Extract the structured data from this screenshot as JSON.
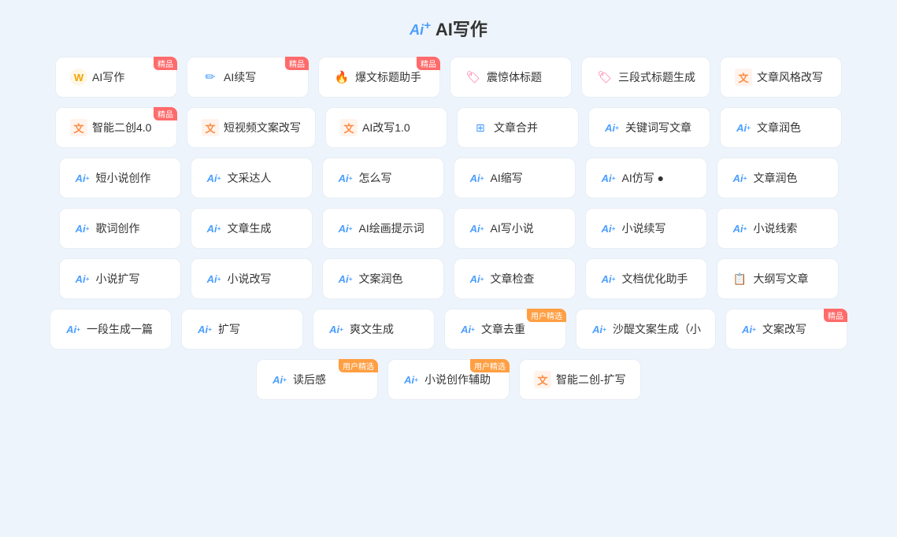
{
  "title": {
    "ai_prefix": "Ai+",
    "text": "AI写作"
  },
  "rows": [
    [
      {
        "id": "ai-write",
        "icon": "w-circle",
        "label": "AI写作",
        "badge": "精品"
      },
      {
        "id": "ai-continue",
        "icon": "pen",
        "label": "AI续写",
        "badge": "精品"
      },
      {
        "id": "headline-helper",
        "icon": "fire",
        "label": "爆文标题助手",
        "badge": "精品"
      },
      {
        "id": "shock-title",
        "icon": "tag-pink",
        "label": "震惊体标题",
        "badge": null
      },
      {
        "id": "three-title",
        "icon": "tag-pink",
        "label": "三段式标题生成",
        "badge": null
      },
      {
        "id": "article-style",
        "icon": "w-orange",
        "label": "文章风格改写",
        "badge": null
      }
    ],
    [
      {
        "id": "smart-create",
        "icon": "w-orange",
        "label": "智能二创4.0",
        "badge": "精品"
      },
      {
        "id": "short-video",
        "icon": "w-orange",
        "label": "短视频文案改写",
        "badge": null
      },
      {
        "id": "ai-rewrite",
        "icon": "w-orange",
        "label": "AI改写1.0",
        "badge": null
      },
      {
        "id": "article-merge",
        "icon": "merge",
        "label": "文章合并",
        "badge": null
      },
      {
        "id": "keyword-write",
        "icon": "ai-plus",
        "label": "关键词写文章",
        "badge": null
      },
      {
        "id": "article-polish",
        "icon": "ai-plus",
        "label": "文章润色",
        "badge": null
      }
    ],
    [
      {
        "id": "short-novel",
        "icon": "ai-plus",
        "label": "短小说创作",
        "badge": null
      },
      {
        "id": "literary",
        "icon": "ai-plus",
        "label": "文采达人",
        "badge": null
      },
      {
        "id": "how-write",
        "icon": "ai-plus",
        "label": "怎么写",
        "badge": null
      },
      {
        "id": "ai-shorten",
        "icon": "ai-plus",
        "label": "AI缩写",
        "badge": null
      },
      {
        "id": "ai-imitate",
        "icon": "ai-plus",
        "label": "AI仿写 ●",
        "badge": null
      },
      {
        "id": "article-polish2",
        "icon": "ai-plus",
        "label": "文章润色",
        "badge": null
      }
    ],
    [
      {
        "id": "lyric",
        "icon": "ai-plus",
        "label": "歌词创作",
        "badge": null
      },
      {
        "id": "article-gen",
        "icon": "ai-plus",
        "label": "文章生成",
        "badge": null
      },
      {
        "id": "ai-draw-prompt",
        "icon": "ai-plus",
        "label": "AI绘画提示词",
        "badge": null
      },
      {
        "id": "ai-novel-write",
        "icon": "ai-plus",
        "label": "AI写小说",
        "badge": null
      },
      {
        "id": "novel-continue",
        "icon": "ai-plus",
        "label": "小说续写",
        "badge": null
      },
      {
        "id": "novel-clue",
        "icon": "ai-plus",
        "label": "小说线索",
        "badge": null
      }
    ],
    [
      {
        "id": "novel-expand",
        "icon": "ai-plus",
        "label": "小说扩写",
        "badge": null
      },
      {
        "id": "novel-rewrite",
        "icon": "ai-plus",
        "label": "小说改写",
        "badge": null
      },
      {
        "id": "copy-polish",
        "icon": "ai-plus",
        "label": "文案润色",
        "badge": null
      },
      {
        "id": "article-check",
        "icon": "ai-plus",
        "label": "文章检查",
        "badge": null
      },
      {
        "id": "doc-optimize",
        "icon": "ai-plus",
        "label": "文档优化助手",
        "badge": null
      },
      {
        "id": "outline-write",
        "icon": "doc",
        "label": "大纲写文章",
        "badge": null
      }
    ],
    [
      {
        "id": "one-para",
        "icon": "ai-plus",
        "label": "一段生成一篇",
        "badge": null
      },
      {
        "id": "expand",
        "icon": "ai-plus",
        "label": "扩写",
        "badge": null
      },
      {
        "id": "fun-gen",
        "icon": "ai-plus",
        "label": "爽文生成",
        "badge": null
      },
      {
        "id": "article-dedup",
        "icon": "ai-plus",
        "label": "文章去重",
        "badge": "用户精选"
      },
      {
        "id": "sha-copy",
        "icon": "ai-plus",
        "label": "沙醍文案生成（小",
        "badge": null
      },
      {
        "id": "copy-rewrite",
        "icon": "ai-plus",
        "label": "文案改写",
        "badge": "精品"
      }
    ],
    [
      {
        "id": "reading-feel",
        "icon": "ai-plus",
        "label": "读后感",
        "badge": "用户精选"
      },
      {
        "id": "novel-assist",
        "icon": "ai-plus",
        "label": "小说创作辅助",
        "badge": "用户精选"
      },
      {
        "id": "smart-expand",
        "icon": "w-orange",
        "label": "智能二创-扩写",
        "badge": null
      }
    ]
  ],
  "badges": {
    "jingpin": "精品",
    "user": "用户精选"
  }
}
